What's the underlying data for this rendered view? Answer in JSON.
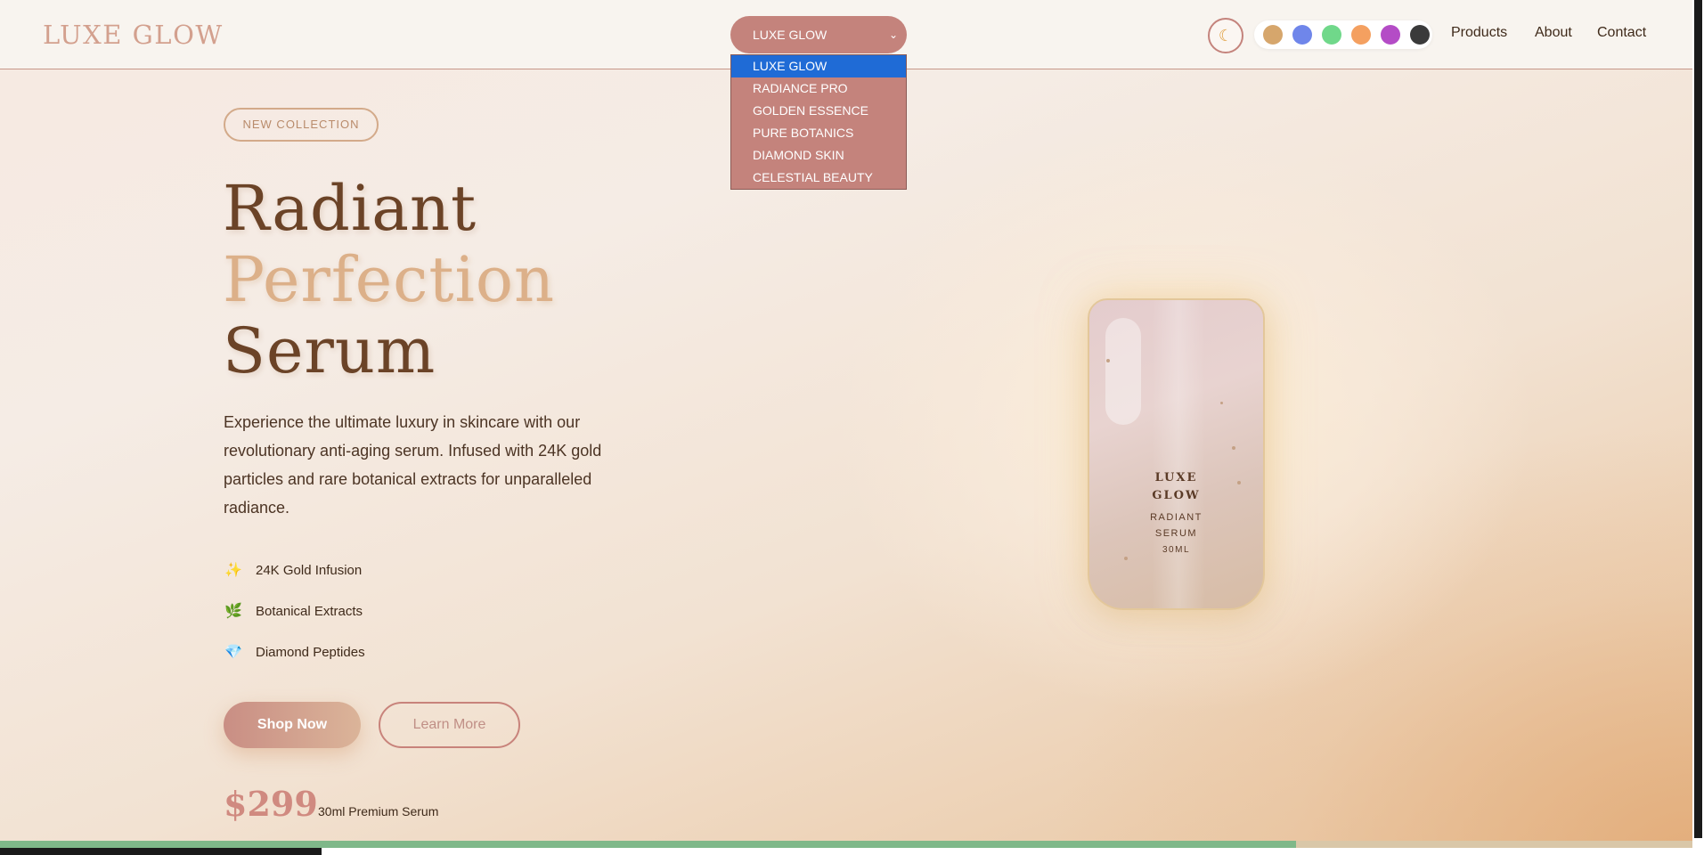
{
  "header": {
    "logo": "LUXE GLOW",
    "brand_select": {
      "selected": "LUXE GLOW",
      "options": [
        "LUXE GLOW",
        "RADIANCE PRO",
        "GOLDEN ESSENCE",
        "PURE BOTANICS",
        "DIAMOND SKIN",
        "CELESTIAL BEAUTY"
      ],
      "highlighted_index": 0
    },
    "theme_toggle_icon": "moon-icon",
    "color_swatches": [
      "#d6a66c",
      "#6f86ea",
      "#70d88a",
      "#f4a060",
      "#b44cc6",
      "#3a3a3a"
    ],
    "nav": [
      "Products",
      "About",
      "Contact"
    ]
  },
  "hero": {
    "badge": "NEW COLLECTION",
    "headline": [
      "Radiant",
      "Perfection",
      "Serum"
    ],
    "description": "Experience the ultimate luxury in skincare with our revolutionary anti-aging serum. Infused with 24K gold particles and rare botanical extracts for unparalleled radiance.",
    "features": [
      {
        "icon": "sparkles-icon",
        "glyph": "✨",
        "label": "24K Gold Infusion"
      },
      {
        "icon": "herb-icon",
        "glyph": "🌿",
        "label": "Botanical Extracts"
      },
      {
        "icon": "gem-icon",
        "glyph": "💎",
        "label": "Diamond Peptides"
      }
    ],
    "primary_button": "Shop Now",
    "secondary_button": "Learn More",
    "price": "$299",
    "price_note": "30ml Premium Serum"
  },
  "product": {
    "brand_line1": "LUXE",
    "brand_line2": "GLOW",
    "sub_line1": "RADIANT",
    "sub_line2": "SERUM",
    "volume": "30ML"
  },
  "progress": {
    "fill_fraction": 0.766
  },
  "scroll": {
    "horizontal_fraction": 0.19,
    "vertical_fraction": 0.98
  },
  "colors": {
    "accent": "#c4837c",
    "gold": "#dcb089",
    "text_dark": "#6b4327"
  }
}
